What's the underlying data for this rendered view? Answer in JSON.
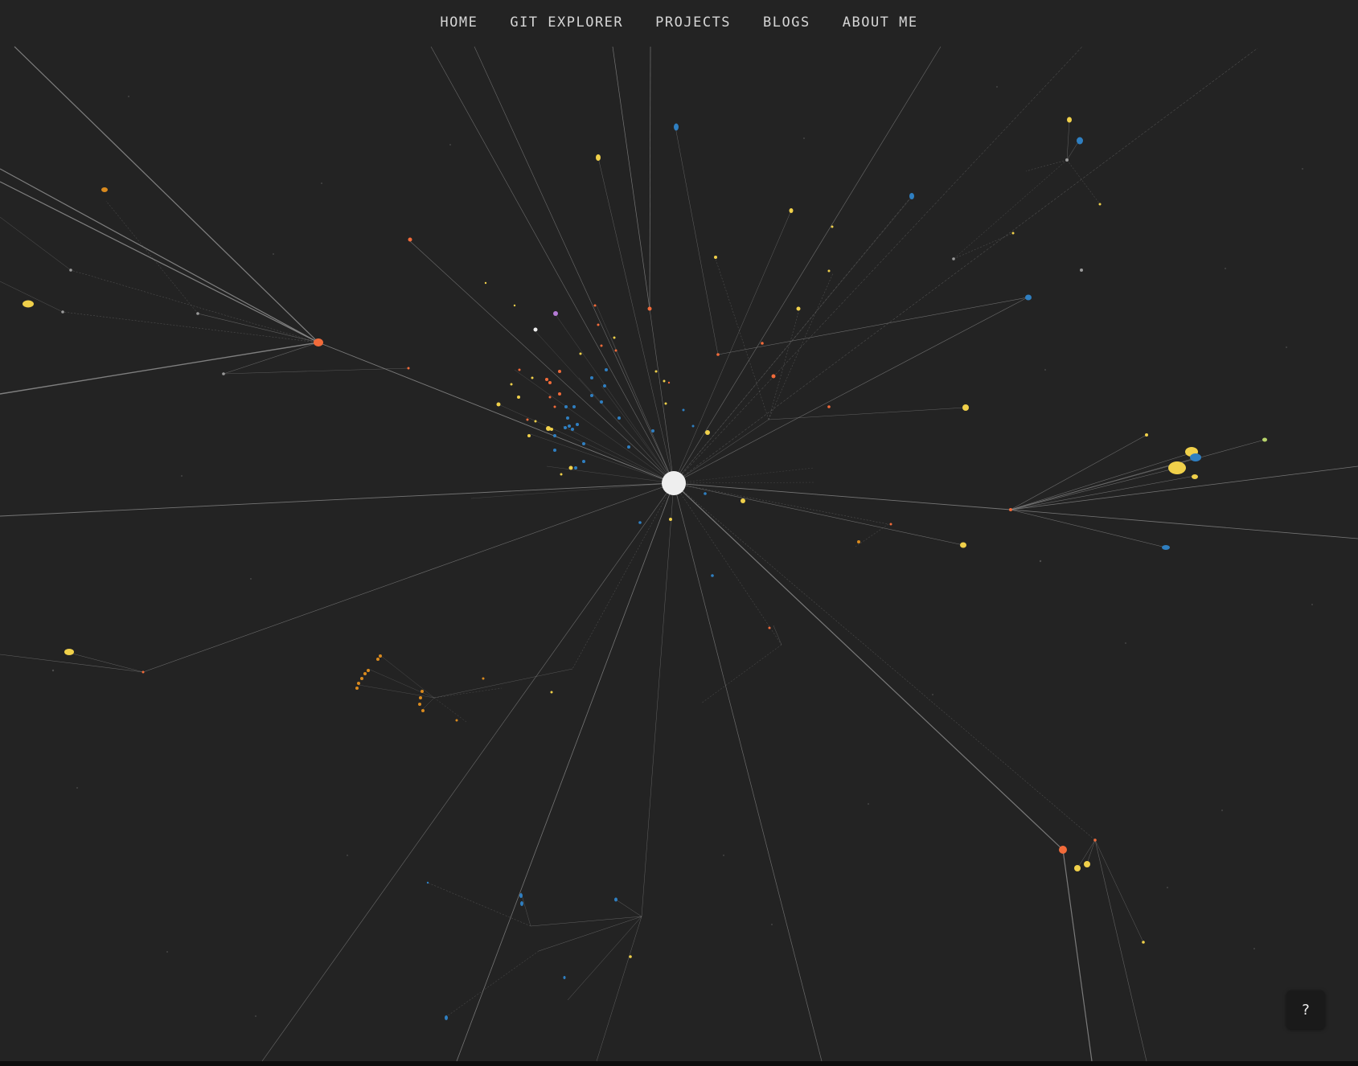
{
  "nav": {
    "home": "HOME",
    "git_explorer": "GIT EXPLORER",
    "projects": "PROJECTS",
    "blogs": "BLOGS",
    "about_me": "ABOUT ME"
  },
  "help": {
    "label": "?"
  },
  "graph": {
    "node_colors": {
      "root": "#eeeeee",
      "orange": "#f26b3a",
      "yellow": "#f0d04a",
      "blue": "#2f7fc1",
      "grey": "#9a9a9a",
      "purple": "#b57bd6",
      "green": "#b7d36b",
      "edge": "#8a8a8a"
    }
  }
}
